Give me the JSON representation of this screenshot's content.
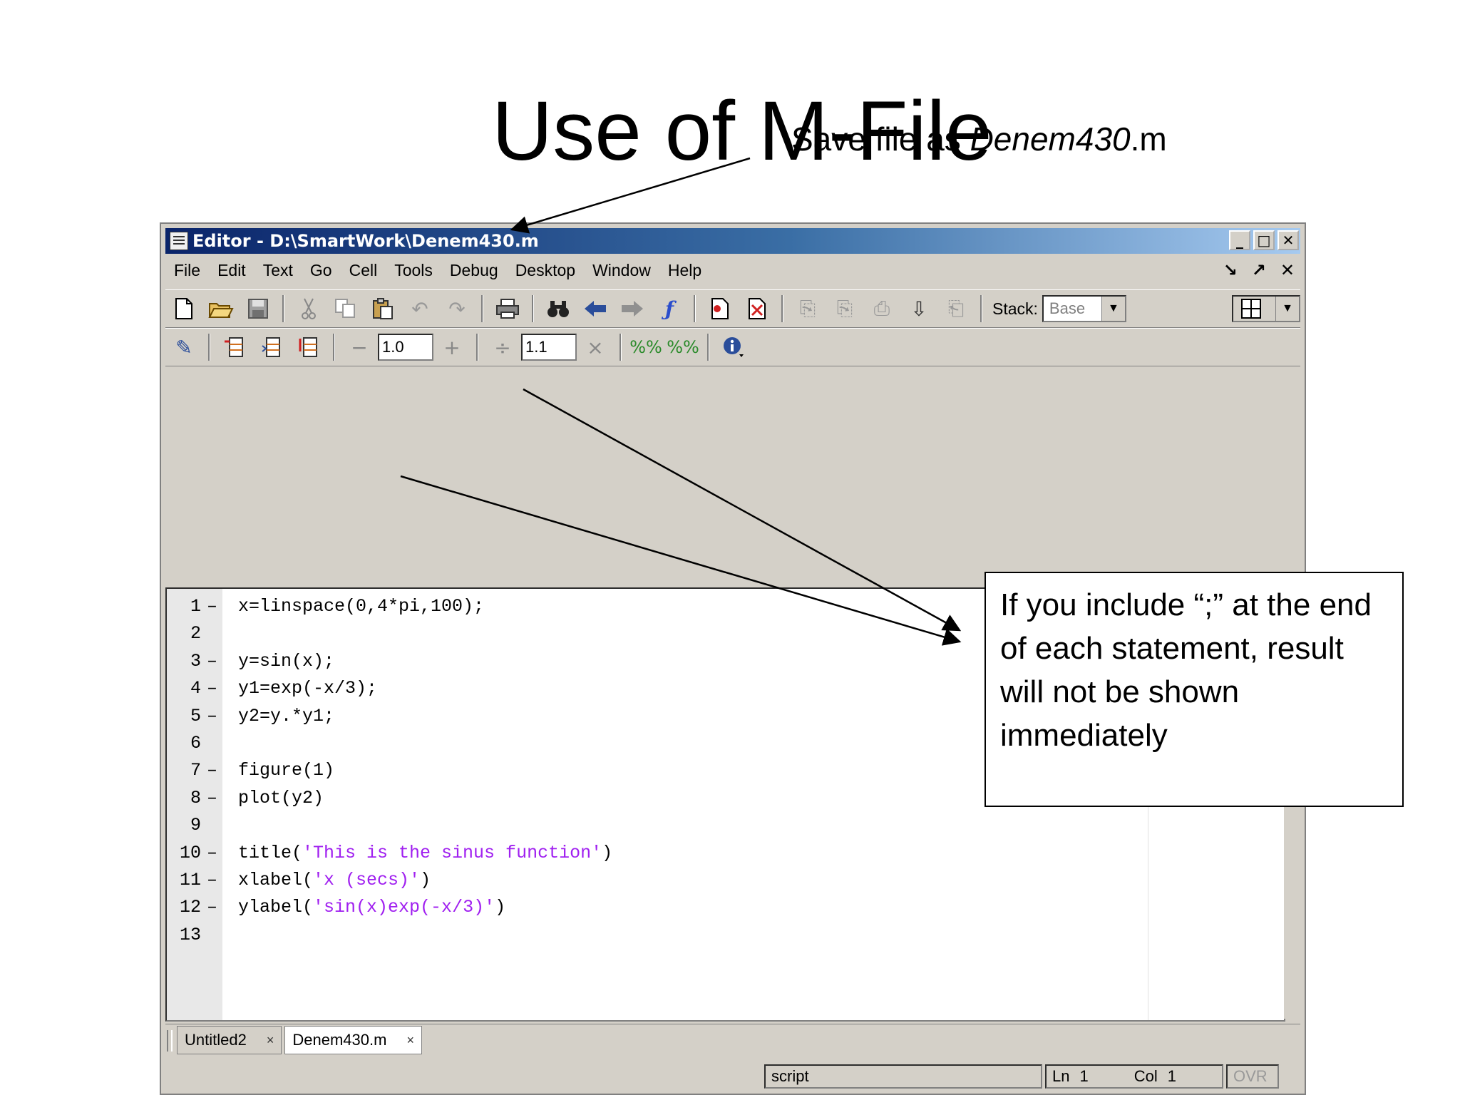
{
  "slide": {
    "title": "Use of M-File",
    "save_note_prefix": "Save file as ",
    "save_note_name": "Denem430",
    "save_note_ext": ".m",
    "callout": "If you include “;” at the end of each statement, result will not be shown immediately"
  },
  "window": {
    "title": "Editor - D:\\SmartWork\\Denem430.m",
    "minimize": "_",
    "maximize": "□",
    "close": "✕"
  },
  "menu": {
    "items": [
      "File",
      "Edit",
      "Text",
      "Go",
      "Cell",
      "Tools",
      "Debug",
      "Desktop",
      "Window",
      "Help"
    ],
    "undock": "↘",
    "maximize": "↗",
    "close": "✕"
  },
  "toolbar": {
    "stack_label": "Stack:",
    "stack_value": "Base",
    "cell_minus": "−",
    "cell_value_1": "1.0",
    "cell_plus": "+",
    "cell_divide": "÷",
    "cell_value_2": "1.1",
    "cell_times": "×"
  },
  "code": {
    "lines": [
      {
        "num": "1",
        "dash": "–",
        "text": "x=linspace(0,4*pi,100);",
        "str": ""
      },
      {
        "num": "2",
        "dash": "",
        "text": "",
        "str": ""
      },
      {
        "num": "3",
        "dash": "–",
        "text": "y=sin(x);",
        "str": ""
      },
      {
        "num": "4",
        "dash": "–",
        "text": "y1=exp(-x/3);",
        "str": ""
      },
      {
        "num": "5",
        "dash": "–",
        "text": "y2=y.*y1;",
        "str": ""
      },
      {
        "num": "6",
        "dash": "",
        "text": "",
        "str": ""
      },
      {
        "num": "7",
        "dash": "–",
        "text": "figure(1)",
        "str": ""
      },
      {
        "num": "8",
        "dash": "–",
        "text": "plot(y2)",
        "str": ""
      },
      {
        "num": "9",
        "dash": "",
        "text": "",
        "str": ""
      },
      {
        "num": "10",
        "dash": "–",
        "text": "title(",
        "str": "'This is the sinus function'",
        "tail": ")"
      },
      {
        "num": "11",
        "dash": "–",
        "text": "xlabel(",
        "str": "'x (secs)'",
        "tail": ")"
      },
      {
        "num": "12",
        "dash": "–",
        "text": "ylabel(",
        "str": "'sin(x)exp(-x/3)'",
        "tail": ")"
      },
      {
        "num": "13",
        "dash": "",
        "text": "",
        "str": ""
      }
    ]
  },
  "tabs": [
    {
      "label": "Untitled2",
      "close": "×"
    },
    {
      "label": "Denem430.m",
      "close": "×"
    }
  ],
  "status": {
    "mode": "script",
    "ln_label": "Ln",
    "ln_value": "1",
    "col_label": "Col",
    "col_value": "1",
    "ovr": "OVR"
  },
  "icons": [
    "new-file-icon",
    "open-folder-icon",
    "save-icon",
    "cut-icon",
    "copy-icon",
    "paste-icon",
    "undo-icon",
    "redo-icon",
    "print-icon",
    "find-icon",
    "back-icon",
    "forward-icon",
    "function-icon",
    "set-breakpoint-icon",
    "clear-breakpoints-icon",
    "step-icon",
    "step-in-icon",
    "step-out-icon",
    "continue-icon",
    "exit-debug-icon",
    "grid-layout-icon",
    "cell-mode-icon",
    "eval-cell-icon",
    "eval-advance-icon",
    "eval-all-icon",
    "insert-cell-divider-icon",
    "remove-cell-divider-icon",
    "info-icon"
  ],
  "colors": {
    "titlebar": "#0a246a",
    "chrome": "#d4d0c8",
    "string": "#a020f0",
    "green_marker": "#3cb44b"
  }
}
